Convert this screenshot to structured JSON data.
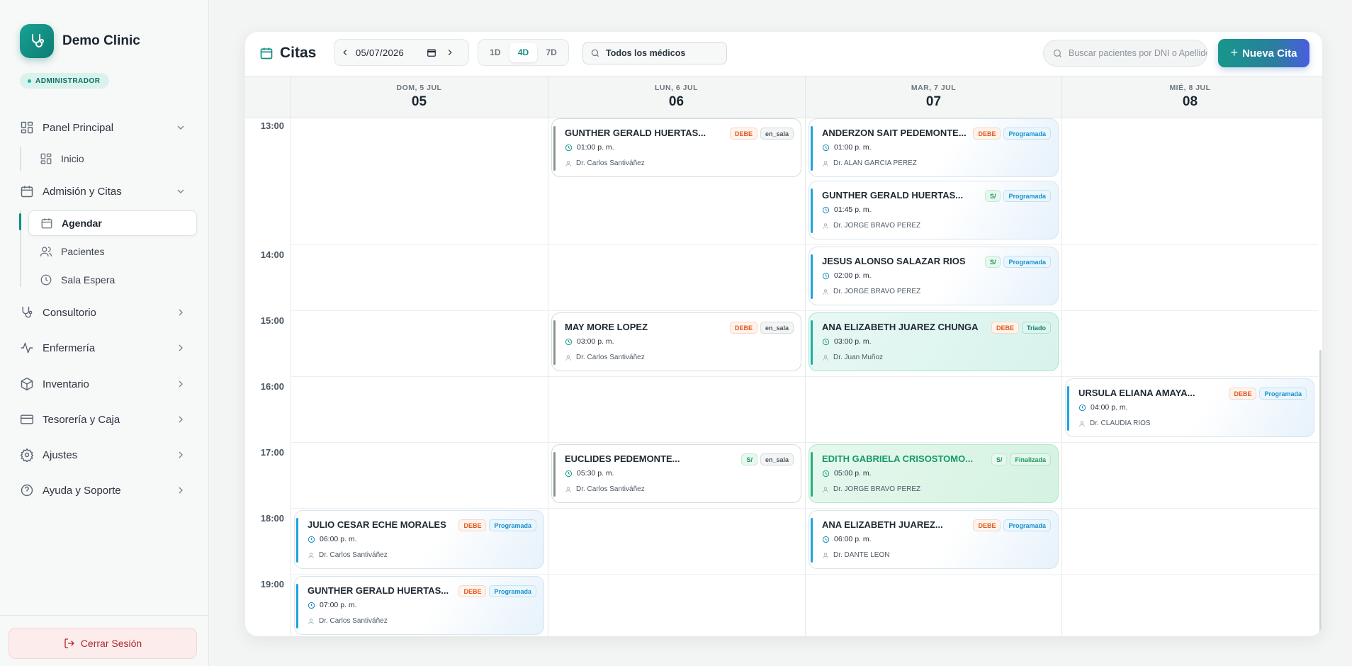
{
  "sidebar": {
    "brand": "Demo Clinic",
    "role": "ADMINISTRADOR",
    "panel": "Panel Principal",
    "inicio": "Inicio",
    "admision": "Admisión y Citas",
    "agendar": "Agendar",
    "pacientes": "Pacientes",
    "sala": "Sala Espera",
    "consultorio": "Consultorio",
    "enfermeria": "Enfermería",
    "inventario": "Inventario",
    "tesoreria": "Tesorería y Caja",
    "ajustes": "Ajustes",
    "ayuda": "Ayuda y Soporte",
    "logout": "Cerrar Sesión"
  },
  "toolbar": {
    "title": "Citas",
    "date": "05/07/2026",
    "views": [
      "1D",
      "4D",
      "7D"
    ],
    "active_view": "4D",
    "doctor_filter": "Todos los médicos",
    "search_placeholder": "Buscar pacientes por DNI o Apellido",
    "new_button": "Nueva Cita"
  },
  "calendar": {
    "days": [
      {
        "name": "DOM, 5 JUL",
        "num": "05"
      },
      {
        "name": "LUN, 6 JUL",
        "num": "06"
      },
      {
        "name": "MAR, 7 JUL",
        "num": "07"
      },
      {
        "name": "MIÉ, 8 JUL",
        "num": "08"
      }
    ],
    "hours": [
      "13:00",
      "14:00",
      "15:00",
      "16:00",
      "17:00",
      "18:00",
      "19:00"
    ],
    "appointments": [
      {
        "name": "GUNTHER GERALD HUERTAS...",
        "time": "01:00 p. m.",
        "doctor": "Dr. Carlos Santiváñez",
        "payment": "DEBE",
        "status": "en_sala"
      },
      {
        "name": "ANDERZON SAIT PEDEMONTE...",
        "time": "01:00 p. m.",
        "doctor": "Dr. ALAN GARCIA PEREZ",
        "payment": "DEBE",
        "status": "Programada"
      },
      {
        "name": "GUNTHER GERALD HUERTAS...",
        "time": "01:45 p. m.",
        "doctor": "Dr. JORGE BRAVO PEREZ",
        "payment": "S/",
        "status": "Programada"
      },
      {
        "name": "JESUS ALONSO SALAZAR RIOS",
        "time": "02:00 p. m.",
        "doctor": "Dr. JORGE BRAVO PEREZ",
        "payment": "S/",
        "status": "Programada"
      },
      {
        "name": "MAY MORE LOPEZ",
        "time": "03:00 p. m.",
        "doctor": "Dr. Carlos Santiváñez",
        "payment": "DEBE",
        "status": "en_sala"
      },
      {
        "name": "ANA ELIZABETH JUAREZ CHUNGA",
        "time": "03:00 p. m.",
        "doctor": "Dr. Juan Muñoz",
        "payment": "DEBE",
        "status": "Triado"
      },
      {
        "name": "URSULA ELIANA AMAYA...",
        "time": "04:00 p. m.",
        "doctor": "Dr. CLAUDIA RIOS",
        "payment": "DEBE",
        "status": "Programada"
      },
      {
        "name": "EUCLIDES PEDEMONTE...",
        "time": "05:30 p. m.",
        "doctor": "Dr. Carlos Santiváñez",
        "payment": "S/",
        "status": "en_sala"
      },
      {
        "name": "EDITH GABRIELA CRISOSTOMO...",
        "time": "05:00 p. m.",
        "doctor": "Dr. JORGE BRAVO PEREZ",
        "payment": "S/",
        "status": "Finalizada"
      },
      {
        "name": "JULIO CESAR ECHE MORALES",
        "time": "06:00 p. m.",
        "doctor": "Dr. Carlos Santiváñez",
        "payment": "DEBE",
        "status": "Programada"
      },
      {
        "name": "ANA ELIZABETH JUAREZ...",
        "time": "06:00 p. m.",
        "doctor": "Dr. DANTE LEON",
        "payment": "DEBE",
        "status": "Programada"
      },
      {
        "name": "GUNTHER GERALD HUERTAS...",
        "time": "07:00 p. m.",
        "doctor": "Dr. Carlos Santiváñez",
        "payment": "DEBE",
        "status": "Programada"
      }
    ]
  }
}
